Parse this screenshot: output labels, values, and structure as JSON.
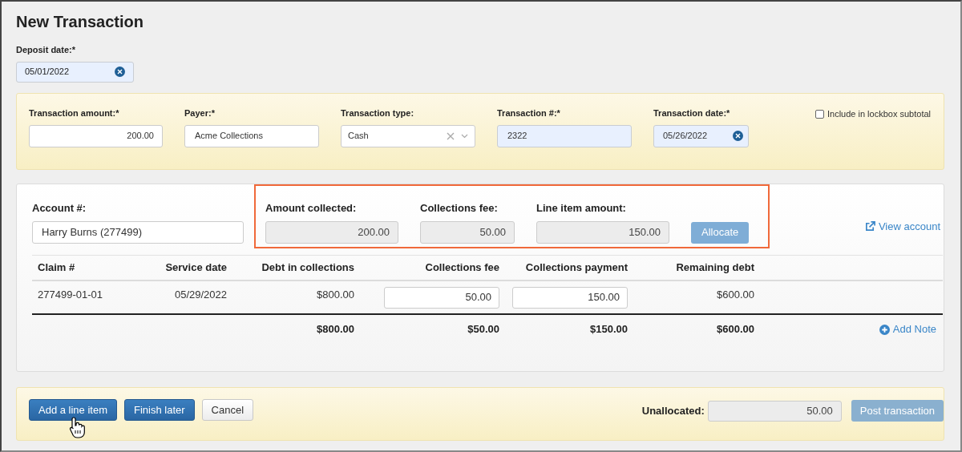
{
  "title": "New Transaction",
  "deposit_date": {
    "label": "Deposit date:*",
    "value": "05/01/2022"
  },
  "transaction_fields": [
    {
      "kind": "amount",
      "label": "Transaction amount:*",
      "value": "200.00"
    },
    {
      "kind": "text",
      "label": "Payer:*",
      "value": "Acme Collections"
    },
    {
      "kind": "select",
      "label": "Transaction type:",
      "value": "Cash"
    },
    {
      "kind": "filled",
      "label": "Transaction #:*",
      "value": "2322"
    },
    {
      "kind": "date",
      "label": "Transaction date:*",
      "value": "05/26/2022"
    }
  ],
  "lockbox_checkbox": {
    "label": "Include in lockbox subtotal",
    "checked": false
  },
  "account": {
    "label": "Account #:",
    "value": "Harry Burns (277499)"
  },
  "summary_fields": [
    {
      "label": "Amount collected:",
      "value": "200.00"
    },
    {
      "label": "Collections fee:",
      "value": "50.00"
    },
    {
      "label": "Line item amount:",
      "value": "150.00"
    }
  ],
  "allocate_button": {
    "label": "Allocate",
    "disabled": true
  },
  "view_account_link": "View account",
  "table": {
    "columns": [
      "Claim #",
      "Service date",
      "Debt in collections",
      "Collections fee",
      "Collections payment",
      "Remaining debt"
    ],
    "rows": [
      {
        "claim": "277499-01-01",
        "service_date": "05/29/2022",
        "debt": "$800.00",
        "fee": "50.00",
        "payment": "150.00",
        "remaining": "$600.00"
      }
    ],
    "totals": {
      "debt": "$800.00",
      "fee": "$50.00",
      "payment": "$150.00",
      "remaining": "$600.00"
    }
  },
  "add_note_link": "Add Note",
  "footer_buttons": [
    {
      "label": "Add a line item",
      "kind": "primary"
    },
    {
      "label": "Finish later",
      "kind": "primary"
    },
    {
      "label": "Cancel",
      "kind": "secondary"
    }
  ],
  "unallocated": {
    "label": "Unallocated:",
    "value": "50.00"
  },
  "post_button": {
    "label": "Post transaction",
    "disabled": true
  }
}
